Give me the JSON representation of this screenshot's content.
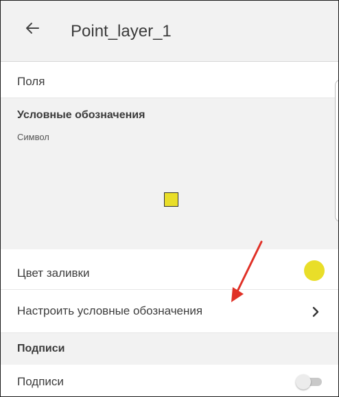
{
  "header": {
    "back_icon": "arrow-left-icon",
    "title": "Point_layer_1"
  },
  "fields": {
    "label": "Поля"
  },
  "legend": {
    "heading": "Условные обозначения",
    "symbol_label": "Символ",
    "symbol_color": "#e9de29"
  },
  "fill_color": {
    "label": "Цвет заливки",
    "color": "#e9de29"
  },
  "configure_legend": {
    "label": "Настроить условные обозначения",
    "icon": "chevron-right-icon"
  },
  "captions_section": {
    "heading": "Подписи"
  },
  "captions_toggle": {
    "label": "Подписи",
    "enabled": false
  },
  "annotation": {
    "arrow_color": "#e03127"
  }
}
